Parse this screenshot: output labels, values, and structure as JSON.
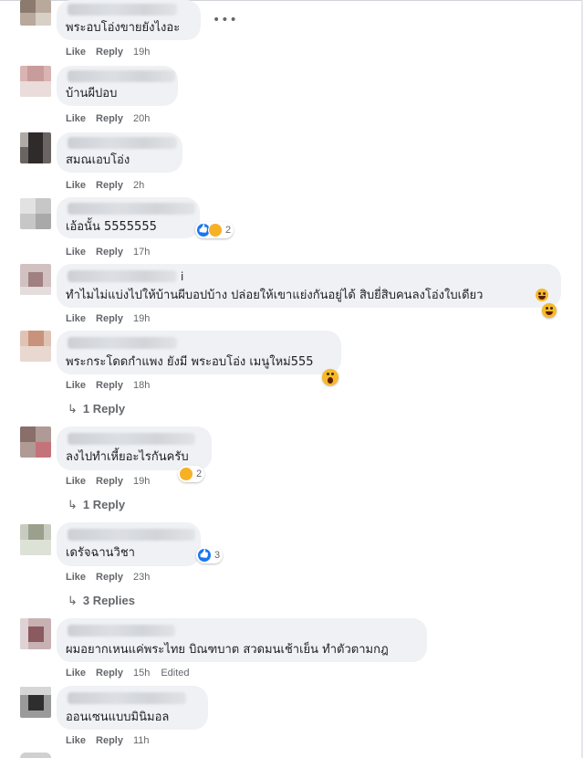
{
  "comments": [
    {
      "text": "พระอบโอ่งขายยังไงอะ",
      "time": "19h",
      "edited": "",
      "reaction_count": "",
      "replies": ""
    },
    {
      "text": "บ้านผีปอบ",
      "time": "20h",
      "edited": "",
      "reaction_count": "",
      "replies": ""
    },
    {
      "text": "สมณเอบโอ่ง",
      "time": "2h",
      "edited": "",
      "reaction_count": "",
      "replies": ""
    },
    {
      "text": "เอ้อนั้น 5555555",
      "time": "17h",
      "edited": "",
      "reaction_count": "2",
      "replies": ""
    },
    {
      "text": "ทำไมไม่แบ่งไปให้บ้านผีบอปบ้าง ปล่อยให้เขาแย่งกันอยู่ได้ สิบยี่สิบคนลงโอ่งใบเดียว",
      "time": "19h",
      "edited": "",
      "reaction_count": "",
      "replies": "",
      "name_suffix": "i"
    },
    {
      "text": "พระกระโดดกำแพง ยังมี พระอบโอ่ง เมนูใหม่555",
      "time": "18h",
      "edited": "",
      "reaction_count": "",
      "replies": "1 Reply"
    },
    {
      "text": "ลงไปทำเหี้ยอะไรกันครับ",
      "time": "19h",
      "edited": "",
      "reaction_count": "2",
      "replies": "1 Reply"
    },
    {
      "text": "เดรัจฉานวิชา",
      "time": "23h",
      "edited": "",
      "reaction_count": "3",
      "replies": "3 Replies"
    },
    {
      "text": "ผมอยากเหนแค่พระไทย บิณฑบาต สวดมนเช้าเย็น ทำตัวตามกฎ",
      "time": "15h",
      "edited": "Edited",
      "reaction_count": "",
      "replies": ""
    },
    {
      "text": "ออนเซนแบบมินิมอล",
      "time": "11h",
      "edited": "",
      "reaction_count": "",
      "replies": ""
    }
  ],
  "labels": {
    "like": "Like",
    "reply": "Reply",
    "more": "•••",
    "reply_arrow": "↳"
  },
  "colors": {
    "bubble": "#eff1f4",
    "meta": "#65676b",
    "like_blue": "#1877f2",
    "emoji_yellow": "#f7b928"
  }
}
